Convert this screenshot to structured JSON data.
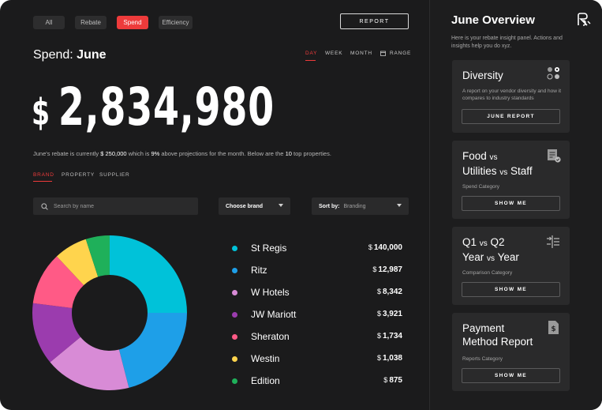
{
  "filters": [
    {
      "label": "All",
      "active": false
    },
    {
      "label": "Rebate",
      "active": false
    },
    {
      "label": "Spend",
      "active": true
    },
    {
      "label": "Efficiency",
      "active": false
    }
  ],
  "report_button": "REPORT",
  "spend": {
    "prefix": "Spend:",
    "month": "June"
  },
  "range_tabs": [
    {
      "label": "DAY",
      "active": true
    },
    {
      "label": "WEEK",
      "active": false
    },
    {
      "label": "MONTH",
      "active": false
    },
    {
      "label": "RANGE",
      "active": false
    }
  ],
  "total": {
    "currency": "$",
    "amount": "2,834,980"
  },
  "summary": {
    "part1": "June's rebate is currently ",
    "rebate": "$ 250,000",
    "part2": " which is ",
    "percent": "9%",
    "part3": " above projections for the month. Below are the ",
    "count": "10",
    "part4": " top properties."
  },
  "category_tabs": [
    {
      "label": "BRAND",
      "active": true
    },
    {
      "label": "PROPERTY",
      "active": false
    },
    {
      "label": "SUPPLIER",
      "active": false
    }
  ],
  "search": {
    "placeholder": "Search by name"
  },
  "brand_select": {
    "label": "Choose brand"
  },
  "sort_select": {
    "label": "Sort by:",
    "value": "Branding"
  },
  "legend": [
    {
      "name": "St Regis",
      "value": "140,000",
      "color": "#00c2d9"
    },
    {
      "name": "Ritz",
      "value": "12,987",
      "color": "#1e9fe8"
    },
    {
      "name": "W Hotels",
      "value": "8,342",
      "color": "#d88bd6"
    },
    {
      "name": "JW Mariott",
      "value": "3,921",
      "color": "#9b3cae"
    },
    {
      "name": "Sheraton",
      "value": "1,734",
      "color": "#ff5a86"
    },
    {
      "name": "Westin",
      "value": "1,038",
      "color": "#ffd44d"
    },
    {
      "name": "Edition",
      "value": "875",
      "color": "#1fb05a"
    }
  ],
  "currency_symbol": "$",
  "donut_shares": [
    0.25,
    0.21,
    0.18,
    0.13,
    0.11,
    0.07,
    0.05
  ],
  "panel": {
    "title": "June Overview",
    "description": "Here is your rebate insight panel. Actions and insights help you do xyz.",
    "cards": [
      {
        "title": "Diversity",
        "subtitle": "A report on your vendor diversity and how it compares to industry standards",
        "button": "JUNE REPORT",
        "icon": "diversity-icon"
      },
      {
        "line1a": "Food",
        "line1vs": "vs",
        "line2a": "Utilities",
        "line2vs": "vs",
        "line2b": "Staff",
        "subtitle": "Spend Category",
        "button": "SHOW ME",
        "icon": "document-check-icon"
      },
      {
        "line1a": "Q1",
        "line1vs": "vs",
        "line1b": "Q2",
        "line2a": "Year",
        "line2vs": "vs",
        "line2b": "Year",
        "subtitle": "Comparison Category",
        "button": "SHOW ME",
        "icon": "compare-icon"
      },
      {
        "line1a": "Payment",
        "line2a": "Method Report",
        "subtitle": "Reports Category",
        "button": "SHOW ME",
        "icon": "dollar-file-icon"
      }
    ]
  }
}
